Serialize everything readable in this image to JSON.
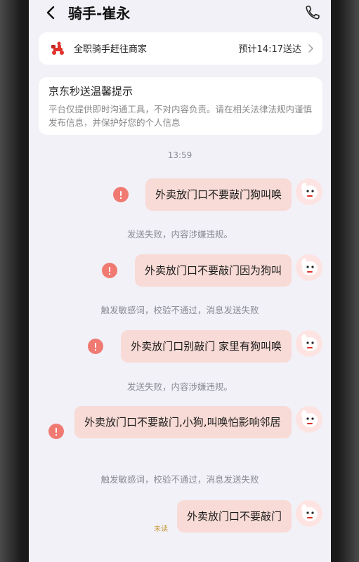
{
  "header": {
    "title": "骑手-崔永"
  },
  "status": {
    "text": "全职骑手赶往商家",
    "eta": "预计14:17送达"
  },
  "notice": {
    "title": "京东秒送温馨提示",
    "body": "平台仅提供即时沟通工具，不对内容负责。请在相关法律法规内谨慎发布信息，并保护好您的个人信息"
  },
  "chat": {
    "time": "13:59",
    "messages": [
      {
        "text": "外卖放门口不要敲门狗叫唤",
        "error": "发送失败，内容涉嫌违规。"
      },
      {
        "text": "外卖放门口不要敲门因为狗叫",
        "error": "触发敏感词，校验不通过，消息发送失败"
      },
      {
        "text": "外卖放门口别敲门 家里有狗叫唤",
        "error": "发送失败，内容涉嫌违规。"
      },
      {
        "text": "外卖放门口不要敲门,小狗,叫唤怕影响邻居",
        "error": "触发敏感词，校验不通过，消息发送失败"
      },
      {
        "text": "外卖放门口不要敲门",
        "status": "未读"
      }
    ]
  },
  "colors": {
    "bubble": "#f8dbd6",
    "error": "#f07a72",
    "background": "#f1f1f7"
  }
}
